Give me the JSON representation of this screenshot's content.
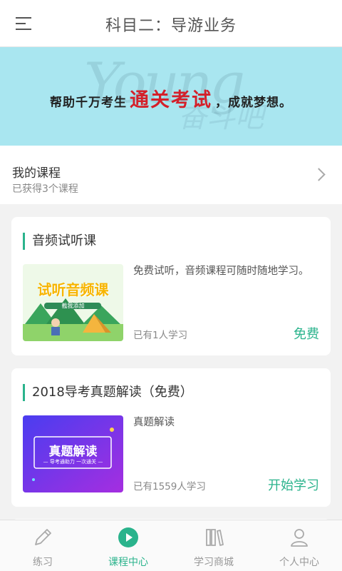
{
  "header": {
    "title": "科目二：导游业务"
  },
  "banner": {
    "text_before": "帮助千万考生",
    "text_highlight": "通关考试",
    "text_after": "，成就梦想。",
    "script_watermark": "Young",
    "script_watermark2": "奋斗吧"
  },
  "my_course": {
    "title": "我的课程",
    "subtitle": "已获得3个课程"
  },
  "courses": [
    {
      "title": "音频试听课",
      "thumb_title": "试听音频课",
      "thumb_tag": "截我添加",
      "description": "免费试听，音频课程可随时随地学习。",
      "learners": "已有1人学习",
      "action": "免费"
    },
    {
      "title": "2018导考真题解读（免费）",
      "thumb_title": "真题解读",
      "thumb_sub": "— 导考通助力 一次通关 —",
      "description": "真题解读",
      "learners": "已有1559人学习",
      "action": "开始学习"
    }
  ],
  "tabs": [
    {
      "label": "练习",
      "icon": "pencil-icon"
    },
    {
      "label": "课程中心",
      "icon": "play-circle-icon"
    },
    {
      "label": "学习商城",
      "icon": "books-icon"
    },
    {
      "label": "个人中心",
      "icon": "person-icon"
    }
  ],
  "colors": {
    "accent": "#2ab38c",
    "banner_bg": "#a9e6f0",
    "highlight_red": "#d4202a"
  }
}
